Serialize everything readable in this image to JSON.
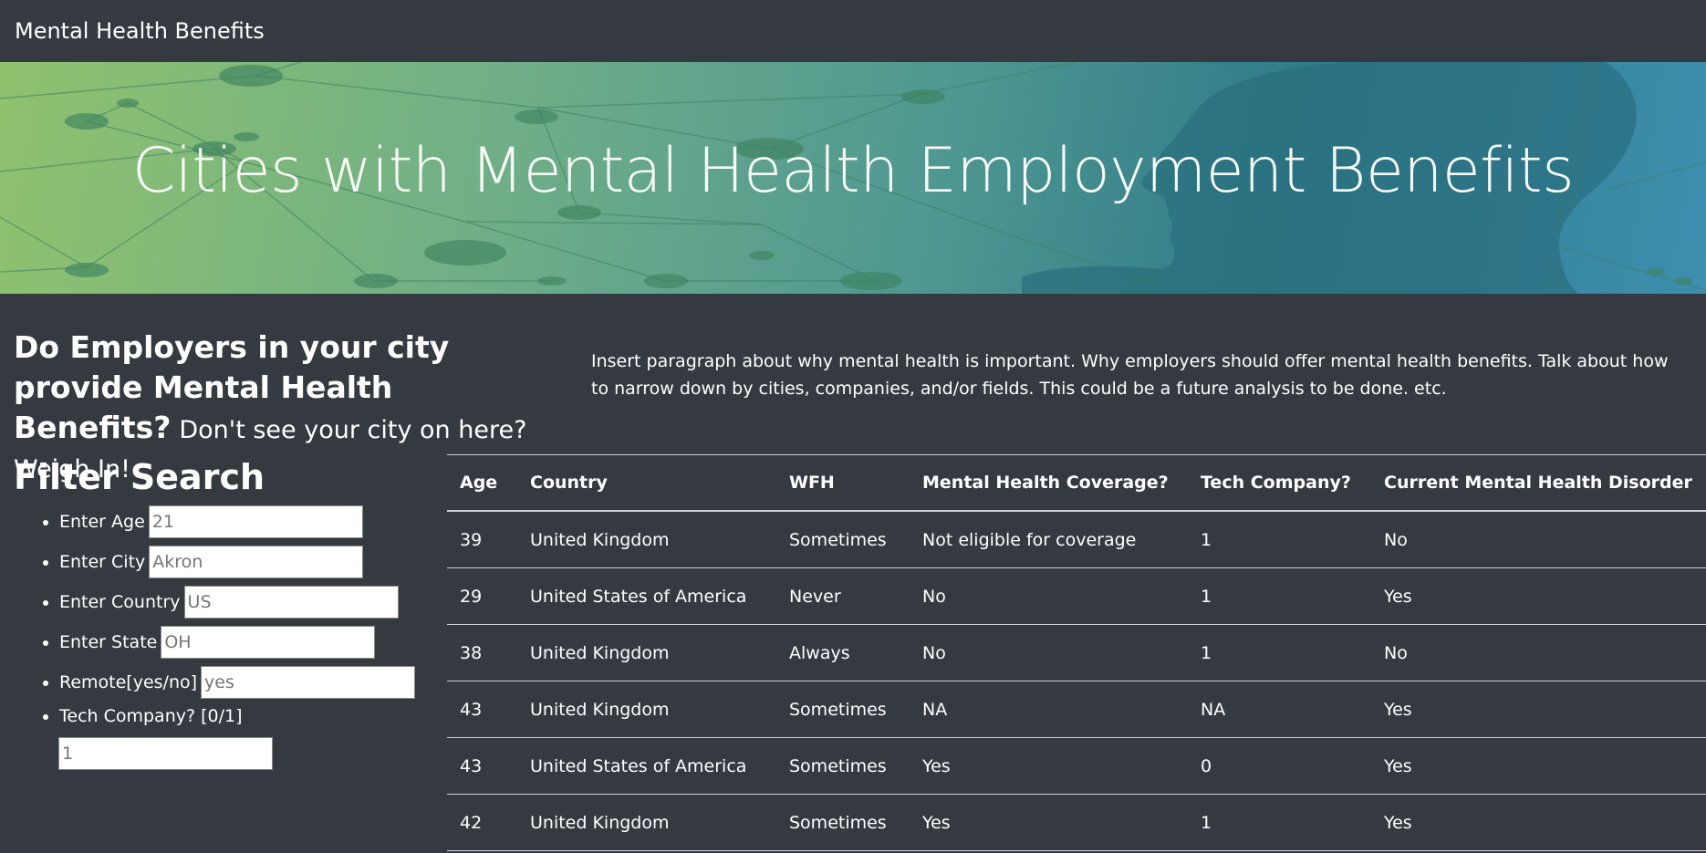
{
  "navbar": {
    "brand": "Mental Health Benefits"
  },
  "hero": {
    "title": "Cities with Mental Health Employment Benefits"
  },
  "intro": {
    "lead": "Do Employers in your city provide Mental Health Benefits?",
    "sub": "Don't see your city on here? Weigh In!"
  },
  "paragraph": "Insert paragraph about why mental health is important. Why employers should offer mental health benefits. Talk about how to narrow down by cities, companies, and/or fields. This could be a future analysis to be done. etc.",
  "filter": {
    "title": "Filter Search",
    "age": {
      "label": "Enter Age",
      "placeholder": "21"
    },
    "city": {
      "label": "Enter City",
      "placeholder": "Akron"
    },
    "country": {
      "label": "Enter Country",
      "placeholder": "US"
    },
    "state": {
      "label": "Enter State",
      "placeholder": "OH"
    },
    "remote": {
      "label": "Remote[yes/no]",
      "placeholder": "yes"
    },
    "tech": {
      "label": "Tech Company? [0/1]",
      "placeholder": "1"
    }
  },
  "table": {
    "headers": [
      "Age",
      "Country",
      "WFH",
      "Mental Health Coverage?",
      "Tech Company?",
      "Current Mental Health Disorder"
    ],
    "rows": [
      [
        "39",
        "United Kingdom",
        "Sometimes",
        "Not eligible for coverage",
        "1",
        "No"
      ],
      [
        "29",
        "United States of America",
        "Never",
        "No",
        "1",
        "Yes"
      ],
      [
        "38",
        "United Kingdom",
        "Always",
        "No",
        "1",
        "No"
      ],
      [
        "43",
        "United Kingdom",
        "Sometimes",
        "NA",
        "NA",
        "Yes"
      ],
      [
        "43",
        "United States of America",
        "Sometimes",
        "Yes",
        "0",
        "Yes"
      ],
      [
        "42",
        "United Kingdom",
        "Sometimes",
        "Yes",
        "1",
        "Yes"
      ]
    ]
  }
}
